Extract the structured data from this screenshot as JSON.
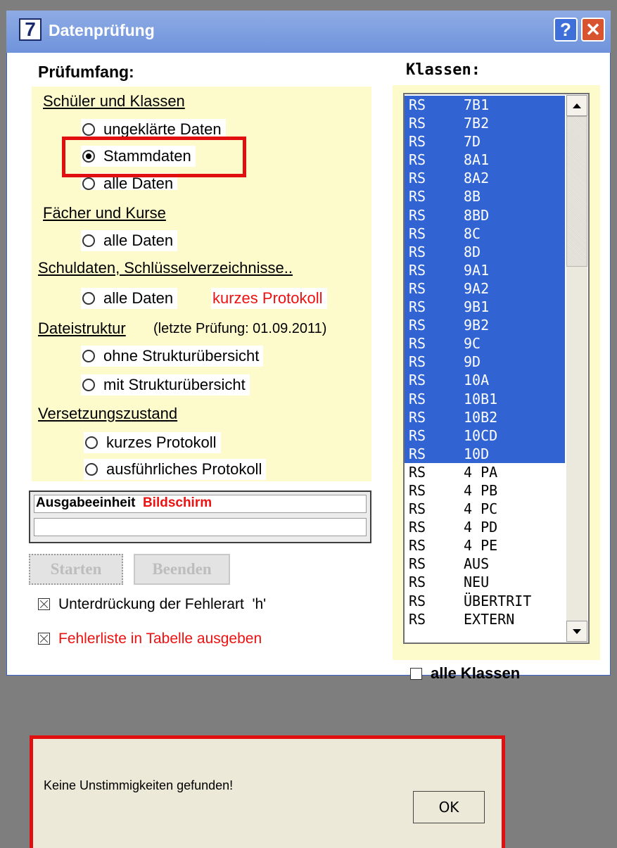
{
  "window": {
    "title_icon": "7",
    "title": "Datenprüfung",
    "help_label": "?",
    "close_label": "✕"
  },
  "pruefumfang": {
    "heading": "Prüfumfang:",
    "schueler_section": "Schüler und Klassen",
    "schueler_options": [
      "ungeklärte Daten",
      "Stammdaten",
      "alle Daten"
    ],
    "schueler_selected": "Stammdaten",
    "faecher_section": "Fächer und Kurse",
    "faecher_option": "alle Daten",
    "schuldaten_section": "Schuldaten, Schlüsselverzeichnisse..",
    "schuldaten_option": "alle Daten",
    "schuldaten_note": "kurzes Protokoll",
    "dateistruktur_section": "Dateistruktur",
    "dateistruktur_note": "(letzte Prüfung: 01.09.2011)",
    "dateistruktur_options": [
      "ohne Strukturübersicht",
      "mit Strukturübersicht"
    ],
    "versetzung_section": "Versetzungszustand",
    "versetzung_options": [
      "kurzes Protokoll",
      "ausführliches Protokoll"
    ]
  },
  "ausgabe": {
    "label": "Ausgabeeinheit",
    "value": "Bildschirm"
  },
  "buttons": {
    "start": "Starten",
    "end": "Beenden"
  },
  "checkboxes": {
    "suppress_h": "Unterdrückung der Fehlerart  'h'",
    "error_table": "Fehlerliste in Tabelle ausgeben"
  },
  "klassen": {
    "heading": "Klassen:",
    "rows": [
      {
        "school": "RS",
        "class": "7B1",
        "selected": true
      },
      {
        "school": "RS",
        "class": "7B2",
        "selected": true
      },
      {
        "school": "RS",
        "class": "7D",
        "selected": true
      },
      {
        "school": "RS",
        "class": "8A1",
        "selected": true
      },
      {
        "school": "RS",
        "class": "8A2",
        "selected": true
      },
      {
        "school": "RS",
        "class": "8B",
        "selected": true
      },
      {
        "school": "RS",
        "class": "8BD",
        "selected": true
      },
      {
        "school": "RS",
        "class": "8C",
        "selected": true
      },
      {
        "school": "RS",
        "class": "8D",
        "selected": true
      },
      {
        "school": "RS",
        "class": "9A1",
        "selected": true
      },
      {
        "school": "RS",
        "class": "9A2",
        "selected": true
      },
      {
        "school": "RS",
        "class": "9B1",
        "selected": true
      },
      {
        "school": "RS",
        "class": "9B2",
        "selected": true
      },
      {
        "school": "RS",
        "class": "9C",
        "selected": true
      },
      {
        "school": "RS",
        "class": "9D",
        "selected": true
      },
      {
        "school": "RS",
        "class": "10A",
        "selected": true
      },
      {
        "school": "RS",
        "class": "10B1",
        "selected": true
      },
      {
        "school": "RS",
        "class": "10B2",
        "selected": true
      },
      {
        "school": "RS",
        "class": "10CD",
        "selected": true
      },
      {
        "school": "RS",
        "class": "10D",
        "selected": true
      },
      {
        "school": "RS",
        "class": "4 PA",
        "selected": false
      },
      {
        "school": "RS",
        "class": "4 PB",
        "selected": false
      },
      {
        "school": "RS",
        "class": "4 PC",
        "selected": false
      },
      {
        "school": "RS",
        "class": "4 PD",
        "selected": false
      },
      {
        "school": "RS",
        "class": "4 PE",
        "selected": false
      },
      {
        "school": "RS",
        "class": "AUS",
        "selected": false
      },
      {
        "school": "RS",
        "class": "NEU",
        "selected": false
      },
      {
        "school": "RS",
        "class": "ÜBERTRIT",
        "selected": false
      },
      {
        "school": "RS",
        "class": "EXTERN",
        "selected": false
      }
    ],
    "all_label": "alle Klassen"
  },
  "message": {
    "text": "Keine Unstimmigkeiten gefunden!",
    "ok": "OK"
  },
  "colors": {
    "titlebar": "#7a9be0",
    "selection": "#3164d2",
    "panel_yellow": "#fdfbcc",
    "highlight_red": "#e10f0f",
    "accent_red": "#ee1111"
  }
}
